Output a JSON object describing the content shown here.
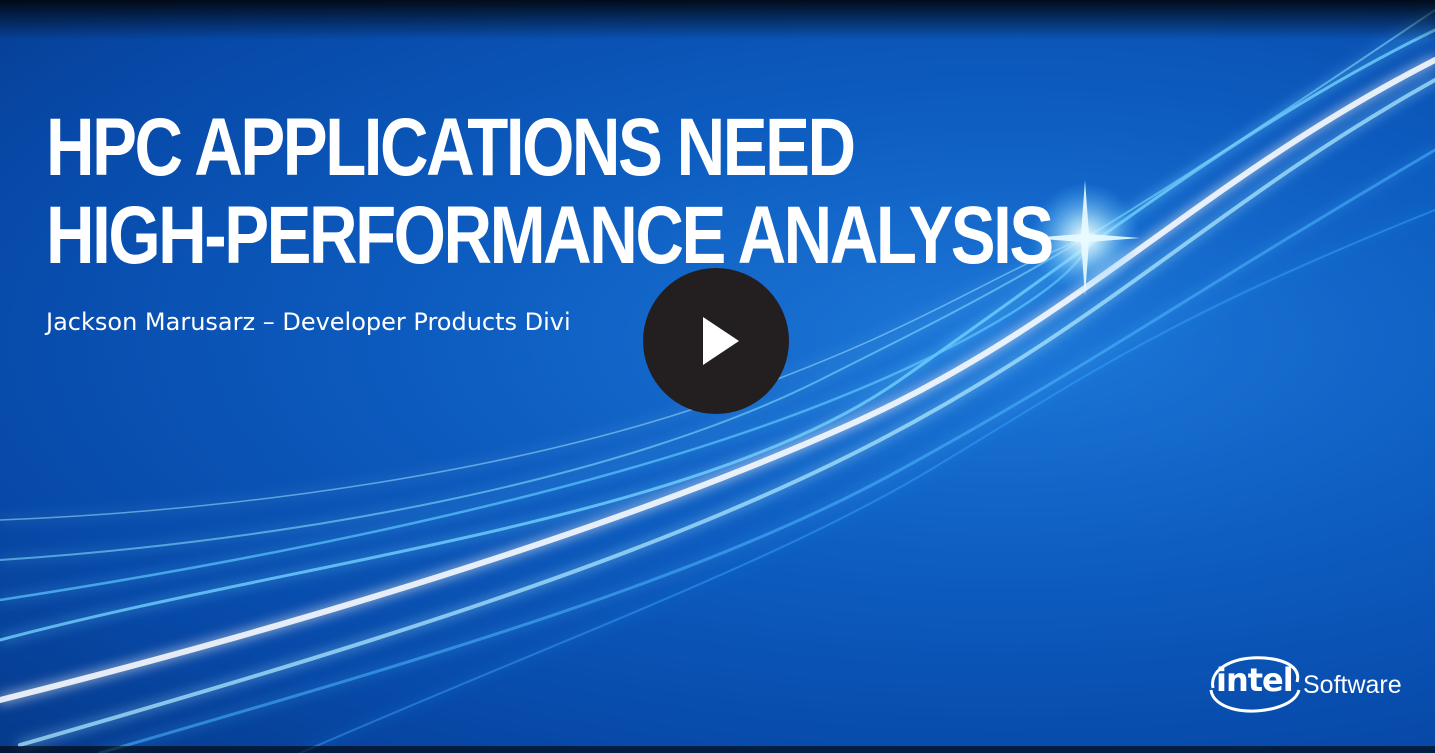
{
  "video": {
    "title_line_1": "HPC APPLICATIONS NEED",
    "title_line_2": "HIGH-PERFORMANCE ANALYSIS",
    "presenter": "Jackson Marusarz – Developer Products Divi",
    "play_icon": "play-icon"
  },
  "branding": {
    "logo_word": "intel",
    "product": "Software",
    "logo_icon": "intel-swirl-icon"
  },
  "colors": {
    "background": "#0b55b8",
    "text": "#ffffff",
    "play_button": "#231f20",
    "streak": "#8fdcff"
  }
}
